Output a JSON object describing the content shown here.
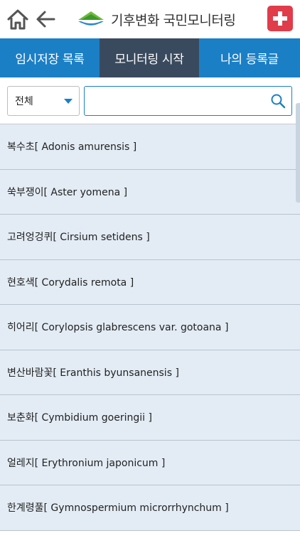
{
  "header": {
    "brand_text": "기후변화 국민모니터링"
  },
  "tabs": [
    {
      "label": "임시저장 목록"
    },
    {
      "label": "모니터링 시작"
    },
    {
      "label": "나의 등록글"
    }
  ],
  "filter": {
    "selected": "전체",
    "search_value": "",
    "search_placeholder": ""
  },
  "species": [
    {
      "label": "복수초[ Adonis amurensis ]"
    },
    {
      "label": "쑥부쟁이[ Aster yomena ]"
    },
    {
      "label": "고려엉겅퀴[ Cirsium setidens ]"
    },
    {
      "label": "현호색[ Corydalis remota ]"
    },
    {
      "label": "히어리[ Corylopsis glabrescens var. gotoana ]"
    },
    {
      "label": "변산바람꽃[ Eranthis byunsanensis ]"
    },
    {
      "label": "보춘화[ Cymbidium goeringii ]"
    },
    {
      "label": "얼레지[ Erythronium japonicum ]"
    },
    {
      "label": "한계령풀[ Gymnospermium microrrhynchum ]"
    }
  ],
  "colors": {
    "primary": "#1b7fc6",
    "active_tab": "#3a4a5e",
    "add_button": "#e03c4a",
    "list_bg": "#e3ecf4"
  }
}
